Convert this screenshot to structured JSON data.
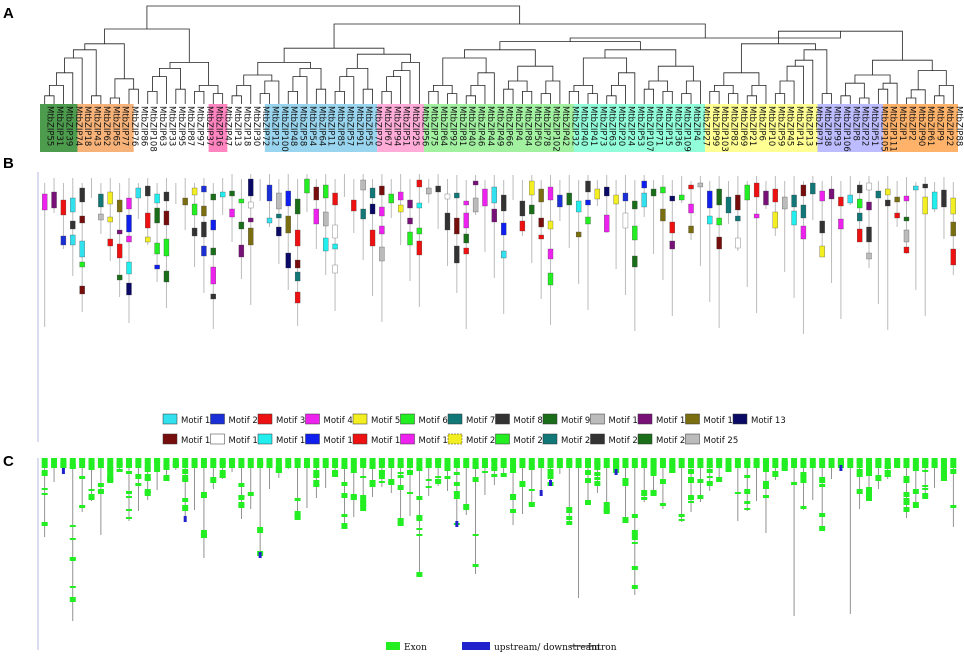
{
  "panels": {
    "a": "A",
    "b": "B",
    "c": "C"
  },
  "tree_leaves": [
    "MtbZIP55",
    "MtbZIP31",
    "MtbZIP39",
    "MtbZIP74",
    "MtbZIP18",
    "MtbZIP43",
    "MtbZIP62",
    "MtbZIP65",
    "MtbZIP77",
    "MtbZIP76",
    "MtbZIP86",
    "MtbZIP108",
    "MtbZIP63",
    "MtbZIP33",
    "MtbZIP95",
    "MtbZIP87",
    "MtbZIP97",
    "MtbZIP37",
    "MtbZIP16",
    "MtbZIP47",
    "MtbZIP13",
    "MtbZIP18",
    "MtbZIP30",
    "MtbZIP72",
    "MtbZIP12",
    "MtbZIP100",
    "MtbZIP48",
    "MtbZIP58",
    "MtbZIP54",
    "MtbZIP64",
    "MtbZIP11",
    "MtbZIP85",
    "MtbZIP57",
    "MtbZIP91",
    "MtbZIP55",
    "MtbZIP70",
    "MtbZIP67",
    "MtbZIP94",
    "MtbZIP51",
    "MtbZIP25",
    "MtbZIP56",
    "MtbZIP75",
    "MtbZIP64",
    "MtbZIP92",
    "MtbZIP81",
    "MtbZIP40",
    "MtbZIP46",
    "MtbZIP44",
    "MtbZIP49",
    "MtbZIP66",
    "MtbZIP4",
    "MtbZIP84",
    "MtbZIP50",
    "MtbZIP78",
    "MtbZIP102",
    "MtbZIP42",
    "MtbZIP32",
    "MtbZIP40",
    "MtbZIP41",
    "MtbZIP73",
    "MtbZIP63",
    "MtbZIP20",
    "MtbZIP24",
    "MtbZIP53",
    "MtbZIP107",
    "MtbZIP71",
    "MtbZIP15",
    "MtbZIP36",
    "MtbZIP109",
    "MtbZIP4",
    "MtbZIP27",
    "MtbZIP99",
    "MtbZIP103",
    "MtbZIP82",
    "MtbZIP69",
    "MtbZIP21",
    "MtbZIP6",
    "MtbZIP10",
    "MtbZIP59",
    "MtbZIP45",
    "MtbZIP14",
    "MtbZIP13",
    "MtbZIP71",
    "MtbZIP38",
    "MtbZIP93",
    "MtbZIP106",
    "MtbZIP8",
    "MtbZIP22",
    "MtbZIP51",
    "MtbZIP105",
    "MtbZIP111",
    "MtbZIP1",
    "MtbZIP2",
    "MtbZIP90",
    "MtbZIP61",
    "MtbZIP9",
    "MtbZIP22",
    "MtbZIP88"
  ],
  "clade_colors": [
    "#2e8b2e",
    "#f4a460",
    "#ffffff",
    "#ff6eb4",
    "#ffffff",
    "#87ceeb",
    "#ff9ed2",
    "#90ee90",
    "#7fffd4",
    "#ffff80",
    "#b0b0ff",
    "#ffa54f"
  ],
  "motif_legend": [
    {
      "label": "Motif 1",
      "color": "#33e0ee"
    },
    {
      "label": "Motif 2",
      "color": "#1b2fd6"
    },
    {
      "label": "Motif 3",
      "color": "#ee1111"
    },
    {
      "label": "Motif 4",
      "color": "#ee22ee"
    },
    {
      "label": "Motif 5",
      "color": "#f2ee22"
    },
    {
      "label": "Motif 6",
      "color": "#22ee22"
    },
    {
      "label": "Motif 7",
      "color": "#117777"
    },
    {
      "label": "Motif 8",
      "color": "#333333"
    },
    {
      "label": "Motif 9",
      "color": "#1a6e1a"
    },
    {
      "label": "Motif 10",
      "color": "#bbbbbb"
    },
    {
      "label": "Motif 11",
      "color": "#771177"
    },
    {
      "label": "Motif 12",
      "color": "#7a6e11"
    },
    {
      "label": "Motif 13",
      "color": "#0a0a66"
    },
    {
      "label": "Motif 14",
      "color": "#770e0e"
    },
    {
      "label": "Motif 15",
      "color": "#ffffff"
    },
    {
      "label": "Motif 16",
      "color": "#22eeee"
    },
    {
      "label": "Motif 17",
      "color": "#0f1fee"
    },
    {
      "label": "Motif 18",
      "color": "#ee1111"
    },
    {
      "label": "Motif 19",
      "color": "#ee22ee"
    },
    {
      "label": "Motif 20",
      "color": "#f2ee22"
    },
    {
      "label": "Motif 21",
      "color": "#22ee22"
    },
    {
      "label": "Motif 22",
      "color": "#117777"
    },
    {
      "label": "Motif 23",
      "color": "#333333"
    },
    {
      "label": "Motif 24",
      "color": "#1a6e1a"
    },
    {
      "label": "Motif 25",
      "color": "#bbbbbb"
    }
  ],
  "gene_legend": [
    {
      "label": "Exon",
      "color": "#22ee22"
    },
    {
      "label": "upstream/ downstream",
      "color": "#2222cc"
    },
    {
      "label": "Intron",
      "color": "#555555"
    }
  ]
}
